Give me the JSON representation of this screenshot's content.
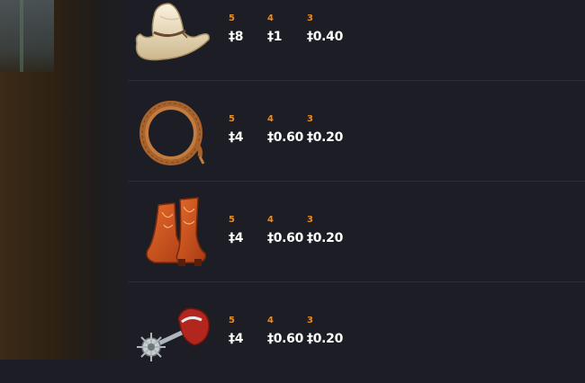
{
  "paytable": {
    "symbols": [
      {
        "icon": "cowboy-hat-icon",
        "payouts": [
          {
            "count": "5",
            "amount": "‡8"
          },
          {
            "count": "4",
            "amount": "‡1"
          },
          {
            "count": "3",
            "amount": "‡0.40"
          }
        ]
      },
      {
        "icon": "lasso-rope-icon",
        "payouts": [
          {
            "count": "5",
            "amount": "‡4"
          },
          {
            "count": "4",
            "amount": "‡0.60"
          },
          {
            "count": "3",
            "amount": "‡0.20"
          }
        ]
      },
      {
        "icon": "cowboy-boots-icon",
        "payouts": [
          {
            "count": "5",
            "amount": "‡4"
          },
          {
            "count": "4",
            "amount": "‡0.60"
          },
          {
            "count": "3",
            "amount": "‡0.20"
          }
        ]
      },
      {
        "icon": "spur-icon",
        "payouts": [
          {
            "count": "5",
            "amount": "‡4"
          },
          {
            "count": "4",
            "amount": "‡0.60"
          },
          {
            "count": "3",
            "amount": "‡0.20"
          }
        ]
      }
    ]
  },
  "colors": {
    "panel_bg": "#1d1e25",
    "count_accent": "#f08c1a",
    "amount_text": "#ffffff",
    "divider": "#2c2e37"
  }
}
